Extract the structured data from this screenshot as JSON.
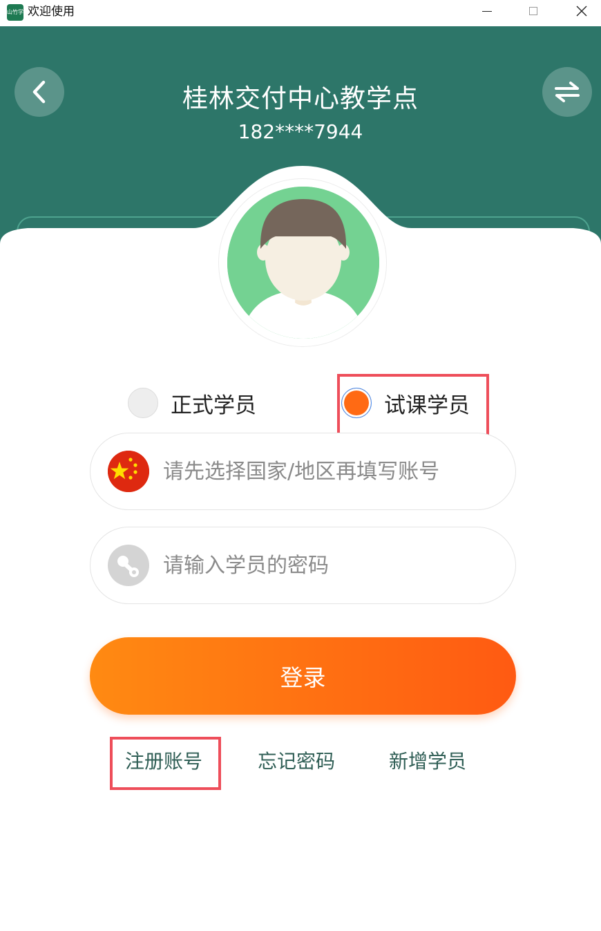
{
  "window": {
    "title": "欢迎使用",
    "app_icon_text": "山竹学"
  },
  "header": {
    "school_name": "桂林交付中心教学点",
    "phone": "182****7944",
    "bg_color": "#2d7669"
  },
  "role": {
    "options": [
      {
        "label": "正式学员",
        "selected": false
      },
      {
        "label": "试课学员",
        "selected": true
      }
    ],
    "accent": "#ff6a14"
  },
  "account": {
    "placeholder": "请先选择国家/地区再填写账号",
    "value": ""
  },
  "password": {
    "placeholder": "请输入学员的密码",
    "value": ""
  },
  "login_label": "登录",
  "links": {
    "register": "注册账号",
    "forgot": "忘记密码",
    "new_student": "新增学员"
  },
  "icons": {
    "back": "chevron-left-icon",
    "switch": "swap-arrows-icon",
    "flag": "china-flag-icon",
    "key": "key-icon"
  }
}
